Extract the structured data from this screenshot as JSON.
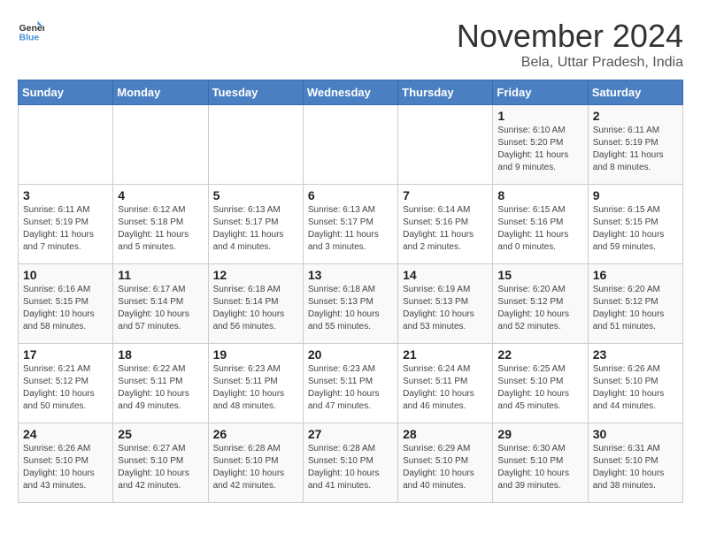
{
  "logo": {
    "general": "General",
    "blue": "Blue"
  },
  "title": "November 2024",
  "subtitle": "Bela, Uttar Pradesh, India",
  "weekdays": [
    "Sunday",
    "Monday",
    "Tuesday",
    "Wednesday",
    "Thursday",
    "Friday",
    "Saturday"
  ],
  "weeks": [
    [
      {
        "day": "",
        "info": ""
      },
      {
        "day": "",
        "info": ""
      },
      {
        "day": "",
        "info": ""
      },
      {
        "day": "",
        "info": ""
      },
      {
        "day": "",
        "info": ""
      },
      {
        "day": "1",
        "info": "Sunrise: 6:10 AM\nSunset: 5:20 PM\nDaylight: 11 hours and 9 minutes."
      },
      {
        "day": "2",
        "info": "Sunrise: 6:11 AM\nSunset: 5:19 PM\nDaylight: 11 hours and 8 minutes."
      }
    ],
    [
      {
        "day": "3",
        "info": "Sunrise: 6:11 AM\nSunset: 5:19 PM\nDaylight: 11 hours and 7 minutes."
      },
      {
        "day": "4",
        "info": "Sunrise: 6:12 AM\nSunset: 5:18 PM\nDaylight: 11 hours and 5 minutes."
      },
      {
        "day": "5",
        "info": "Sunrise: 6:13 AM\nSunset: 5:17 PM\nDaylight: 11 hours and 4 minutes."
      },
      {
        "day": "6",
        "info": "Sunrise: 6:13 AM\nSunset: 5:17 PM\nDaylight: 11 hours and 3 minutes."
      },
      {
        "day": "7",
        "info": "Sunrise: 6:14 AM\nSunset: 5:16 PM\nDaylight: 11 hours and 2 minutes."
      },
      {
        "day": "8",
        "info": "Sunrise: 6:15 AM\nSunset: 5:16 PM\nDaylight: 11 hours and 0 minutes."
      },
      {
        "day": "9",
        "info": "Sunrise: 6:15 AM\nSunset: 5:15 PM\nDaylight: 10 hours and 59 minutes."
      }
    ],
    [
      {
        "day": "10",
        "info": "Sunrise: 6:16 AM\nSunset: 5:15 PM\nDaylight: 10 hours and 58 minutes."
      },
      {
        "day": "11",
        "info": "Sunrise: 6:17 AM\nSunset: 5:14 PM\nDaylight: 10 hours and 57 minutes."
      },
      {
        "day": "12",
        "info": "Sunrise: 6:18 AM\nSunset: 5:14 PM\nDaylight: 10 hours and 56 minutes."
      },
      {
        "day": "13",
        "info": "Sunrise: 6:18 AM\nSunset: 5:13 PM\nDaylight: 10 hours and 55 minutes."
      },
      {
        "day": "14",
        "info": "Sunrise: 6:19 AM\nSunset: 5:13 PM\nDaylight: 10 hours and 53 minutes."
      },
      {
        "day": "15",
        "info": "Sunrise: 6:20 AM\nSunset: 5:12 PM\nDaylight: 10 hours and 52 minutes."
      },
      {
        "day": "16",
        "info": "Sunrise: 6:20 AM\nSunset: 5:12 PM\nDaylight: 10 hours and 51 minutes."
      }
    ],
    [
      {
        "day": "17",
        "info": "Sunrise: 6:21 AM\nSunset: 5:12 PM\nDaylight: 10 hours and 50 minutes."
      },
      {
        "day": "18",
        "info": "Sunrise: 6:22 AM\nSunset: 5:11 PM\nDaylight: 10 hours and 49 minutes."
      },
      {
        "day": "19",
        "info": "Sunrise: 6:23 AM\nSunset: 5:11 PM\nDaylight: 10 hours and 48 minutes."
      },
      {
        "day": "20",
        "info": "Sunrise: 6:23 AM\nSunset: 5:11 PM\nDaylight: 10 hours and 47 minutes."
      },
      {
        "day": "21",
        "info": "Sunrise: 6:24 AM\nSunset: 5:11 PM\nDaylight: 10 hours and 46 minutes."
      },
      {
        "day": "22",
        "info": "Sunrise: 6:25 AM\nSunset: 5:10 PM\nDaylight: 10 hours and 45 minutes."
      },
      {
        "day": "23",
        "info": "Sunrise: 6:26 AM\nSunset: 5:10 PM\nDaylight: 10 hours and 44 minutes."
      }
    ],
    [
      {
        "day": "24",
        "info": "Sunrise: 6:26 AM\nSunset: 5:10 PM\nDaylight: 10 hours and 43 minutes."
      },
      {
        "day": "25",
        "info": "Sunrise: 6:27 AM\nSunset: 5:10 PM\nDaylight: 10 hours and 42 minutes."
      },
      {
        "day": "26",
        "info": "Sunrise: 6:28 AM\nSunset: 5:10 PM\nDaylight: 10 hours and 42 minutes."
      },
      {
        "day": "27",
        "info": "Sunrise: 6:28 AM\nSunset: 5:10 PM\nDaylight: 10 hours and 41 minutes."
      },
      {
        "day": "28",
        "info": "Sunrise: 6:29 AM\nSunset: 5:10 PM\nDaylight: 10 hours and 40 minutes."
      },
      {
        "day": "29",
        "info": "Sunrise: 6:30 AM\nSunset: 5:10 PM\nDaylight: 10 hours and 39 minutes."
      },
      {
        "day": "30",
        "info": "Sunrise: 6:31 AM\nSunset: 5:10 PM\nDaylight: 10 hours and 38 minutes."
      }
    ]
  ]
}
